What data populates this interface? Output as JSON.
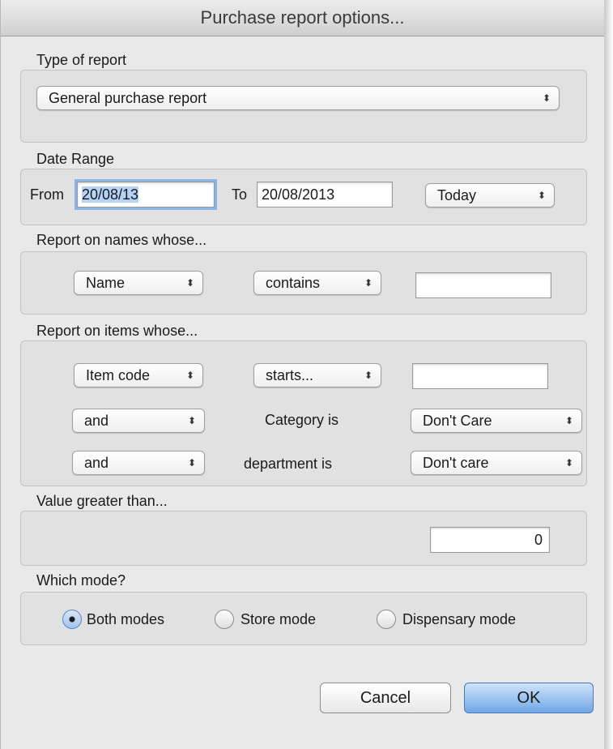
{
  "window": {
    "title": "Purchase report options..."
  },
  "report_type": {
    "label": "Type of report",
    "selected": "General purchase report"
  },
  "date_range": {
    "label": "Date Range",
    "from_label": "From",
    "from_value": "20/08/13",
    "to_label": "To",
    "to_value": "20/08/2013",
    "preset": "Today"
  },
  "names": {
    "label": "Report on names whose...",
    "field": "Name",
    "operator": "contains",
    "value": ""
  },
  "items": {
    "label": "Report on items whose...",
    "field": "Item code",
    "operator": "starts...",
    "value": "",
    "row2_conj": "and",
    "row2_label": "Category is",
    "row2_value": "Don't Care",
    "row3_conj": "and",
    "row3_label": "department is",
    "row3_value": "Don't care"
  },
  "value": {
    "label": "Value greater than...",
    "amount": "0"
  },
  "mode": {
    "label": "Which mode?",
    "options": [
      "Both modes",
      "Store mode",
      "Dispensary mode"
    ],
    "selected": "Both modes"
  },
  "buttons": {
    "cancel": "Cancel",
    "ok": "OK"
  },
  "icons": {
    "popup_arrow": "updown-arrows-icon"
  }
}
